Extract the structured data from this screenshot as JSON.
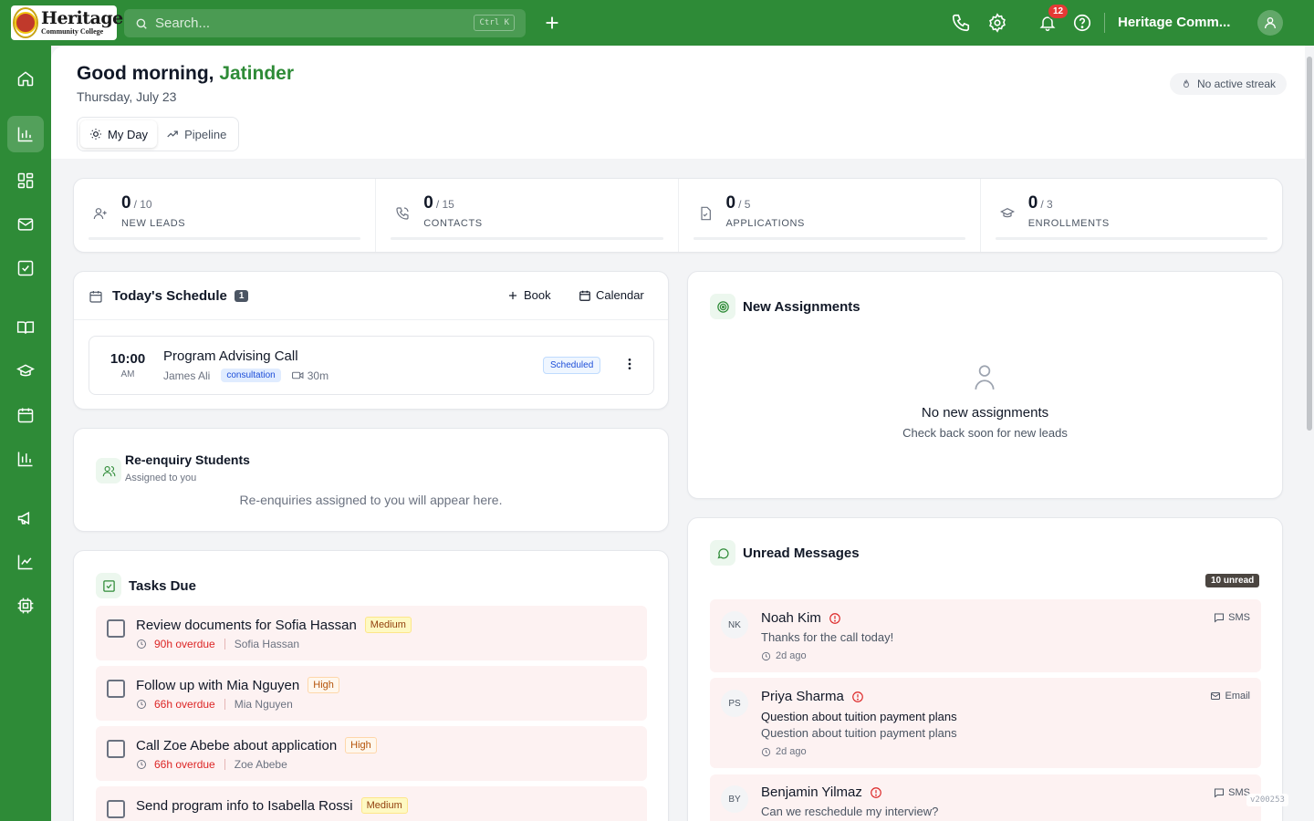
{
  "app": {
    "logo_name": "Heritage",
    "logo_sub": "Community College",
    "search_placeholder": "Search...",
    "search_shortcut": "Ctrl K",
    "notification_count": "12",
    "org_name": "Heritage Comm..."
  },
  "icons": {
    "topbar": [
      "search-icon",
      "plus-icon",
      "phone-icon",
      "gear-icon",
      "bell-icon",
      "help-icon",
      "user-icon"
    ],
    "sidebar": [
      "home-icon",
      "bar-chart-icon",
      "grid-icon",
      "mail-icon",
      "check-square-icon",
      "book-icon",
      "graduation-cap-icon",
      "calendar-icon",
      "chart-icon",
      "megaphone-icon",
      "trend-line-icon",
      "chip-icon"
    ]
  },
  "colors": {
    "brand": "#2e8b37",
    "overdue": "#dc2626",
    "badge": "#e53935"
  },
  "header": {
    "greeting_prefix": "Good morning,",
    "user_name": "Jatinder",
    "date": "Thursday, July 23",
    "streak": "No active streak",
    "tabs": [
      {
        "label": "My Day",
        "active": true
      },
      {
        "label": "Pipeline",
        "active": false
      }
    ]
  },
  "stats": [
    {
      "value": "0",
      "total": "/ 10",
      "label": "NEW LEADS",
      "progress": 0
    },
    {
      "value": "0",
      "total": "/ 15",
      "label": "CONTACTS",
      "progress": 0
    },
    {
      "value": "0",
      "total": "/ 5",
      "label": "APPLICATIONS",
      "progress": 0
    },
    {
      "value": "0",
      "total": "/ 3",
      "label": "ENROLLMENTS",
      "progress": 0
    }
  ],
  "schedule": {
    "title": "Today's Schedule",
    "count": "1",
    "book_label": "Book",
    "calendar_label": "Calendar",
    "appointment": {
      "time": "10:00",
      "ampm": "AM",
      "title": "Program Advising Call",
      "person": "James Ali",
      "tag": "consultation",
      "duration": "30m",
      "status": "Scheduled"
    }
  },
  "reenquiry": {
    "title": "Re-enquiry Students",
    "subtitle": "Assigned to you",
    "empty": "Re-enquiries assigned to you will appear here."
  },
  "tasks": {
    "title": "Tasks Due",
    "items": [
      {
        "title": "Review documents for Sofia Hassan",
        "priority": "Medium",
        "overdue": "90h overdue",
        "person": "Sofia Hassan"
      },
      {
        "title": "Follow up with Mia Nguyen",
        "priority": "High",
        "overdue": "66h overdue",
        "person": "Mia Nguyen"
      },
      {
        "title": "Call Zoe Abebe about application",
        "priority": "High",
        "overdue": "66h overdue",
        "person": "Zoe Abebe"
      },
      {
        "title": "Send program info to Isabella Rossi",
        "priority": "Medium"
      }
    ]
  },
  "assignments": {
    "title": "New Assignments",
    "empty_title": "No new assignments",
    "empty_sub": "Check back soon for new leads"
  },
  "messages": {
    "title": "Unread Messages",
    "unread": "10 unread",
    "items": [
      {
        "initials": "NK",
        "name": "Noah Kim",
        "channel": "SMS",
        "preview": "Thanks for the call today!",
        "time": "2d ago"
      },
      {
        "initials": "PS",
        "name": "Priya Sharma",
        "channel": "Email",
        "subject": "Question about tuition payment plans",
        "preview": "Question about tuition payment plans",
        "time": "2d ago"
      },
      {
        "initials": "BY",
        "name": "Benjamin Yilmaz",
        "channel": "SMS",
        "preview": "Can we reschedule my interview?"
      }
    ]
  },
  "version": "v200253"
}
